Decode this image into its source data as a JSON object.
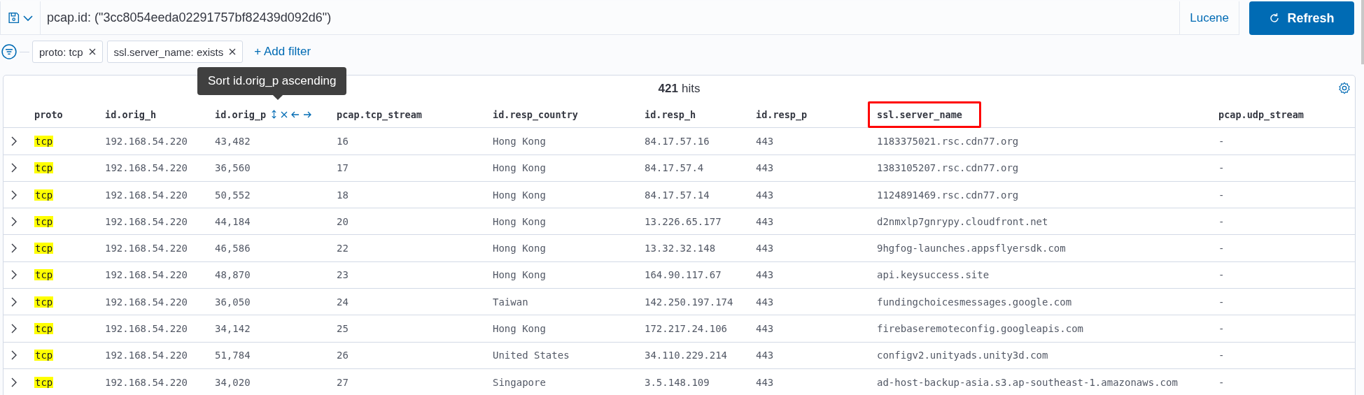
{
  "query_bar": {
    "value": "pcap.id: (\"3cc8054eeda02291757bf82439d092d6\")",
    "language": "Lucene",
    "refresh_label": "Refresh"
  },
  "filters": [
    {
      "label": "proto: tcp"
    },
    {
      "label": "ssl.server_name: exists"
    }
  ],
  "add_filter": "+ Add filter",
  "tooltip": "Sort id.orig_p ascending",
  "hits": {
    "count": "421",
    "label": "hits"
  },
  "columns": [
    {
      "label": "proto",
      "hovered": false,
      "outlined": false
    },
    {
      "label": "id.orig_h",
      "hovered": false,
      "outlined": false
    },
    {
      "label": "id.orig_p",
      "hovered": true,
      "outlined": false
    },
    {
      "label": "pcap.tcp_stream",
      "hovered": false,
      "outlined": false
    },
    {
      "label": "id.resp_country",
      "hovered": false,
      "outlined": false
    },
    {
      "label": "id.resp_h",
      "hovered": false,
      "outlined": false
    },
    {
      "label": "id.resp_p",
      "hovered": false,
      "outlined": false
    },
    {
      "label": "ssl.server_name",
      "hovered": false,
      "outlined": true
    },
    {
      "label": "pcap.udp_stream",
      "hovered": false,
      "outlined": false
    }
  ],
  "rows": [
    {
      "expanded": false,
      "proto": {
        "text": "tcp",
        "match": true
      },
      "cells": [
        "192.168.54.220",
        "43,482",
        "16",
        "Hong Kong",
        "84.17.57.16",
        "443",
        "1183375021.rsc.cdn77.org",
        "-"
      ]
    },
    {
      "expanded": false,
      "proto": {
        "text": "tcp",
        "match": true
      },
      "cells": [
        "192.168.54.220",
        "36,560",
        "17",
        "Hong Kong",
        "84.17.57.4",
        "443",
        "1383105207.rsc.cdn77.org",
        "-"
      ]
    },
    {
      "expanded": false,
      "proto": {
        "text": "tcp",
        "match": true
      },
      "cells": [
        "192.168.54.220",
        "50,552",
        "18",
        "Hong Kong",
        "84.17.57.14",
        "443",
        "1124891469.rsc.cdn77.org",
        "-"
      ]
    },
    {
      "expanded": false,
      "proto": {
        "text": "tcp",
        "match": true
      },
      "cells": [
        "192.168.54.220",
        "44,184",
        "20",
        "Hong Kong",
        "13.226.65.177",
        "443",
        "d2nmxlp7gnrypy.cloudfront.net",
        "-"
      ]
    },
    {
      "expanded": false,
      "proto": {
        "text": "tcp",
        "match": true
      },
      "cells": [
        "192.168.54.220",
        "46,586",
        "22",
        "Hong Kong",
        "13.32.32.148",
        "443",
        "9hgfog-launches.appsflyersdk.com",
        "-"
      ]
    },
    {
      "expanded": false,
      "proto": {
        "text": "tcp",
        "match": true
      },
      "cells": [
        "192.168.54.220",
        "48,870",
        "23",
        "Hong Kong",
        "164.90.117.67",
        "443",
        "api.keysuccess.site",
        "-"
      ]
    },
    {
      "expanded": false,
      "proto": {
        "text": "tcp",
        "match": true
      },
      "cells": [
        "192.168.54.220",
        "36,050",
        "24",
        "Taiwan",
        "142.250.197.174",
        "443",
        "fundingchoicesmessages.google.com",
        "-"
      ]
    },
    {
      "expanded": false,
      "proto": {
        "text": "tcp",
        "match": true
      },
      "cells": [
        "192.168.54.220",
        "34,142",
        "25",
        "Hong Kong",
        "172.217.24.106",
        "443",
        "firebaseremoteconfig.googleapis.com",
        "-"
      ]
    },
    {
      "expanded": false,
      "proto": {
        "text": "tcp",
        "match": true
      },
      "cells": [
        "192.168.54.220",
        "51,784",
        "26",
        "United States",
        "34.110.229.214",
        "443",
        "configv2.unityads.unity3d.com",
        "-"
      ]
    },
    {
      "expanded": false,
      "proto": {
        "text": "tcp",
        "match": true
      },
      "cells": [
        "192.168.54.220",
        "34,020",
        "27",
        "Singapore",
        "3.5.148.109",
        "443",
        "ad-host-backup-asia.s3.ap-southeast-1.amazonaws.com",
        "-"
      ]
    }
  ]
}
